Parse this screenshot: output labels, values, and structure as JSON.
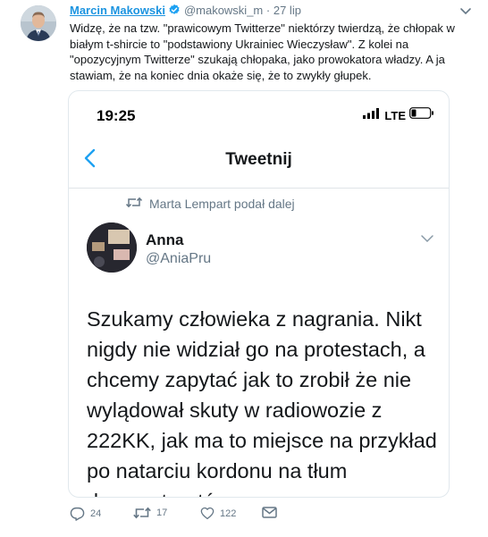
{
  "tweet": {
    "author_name": "Marcin Makowski",
    "author_handle": "@makowski_m",
    "separator": "·",
    "time": "27 lip",
    "text": "Widzę, że na tzw. \"prawicowym Twitterze\" niektórzy twierdzą, że chłopak w białym t-shircie to \"podstawiony Ukrainiec Wieczysław\". Z kolei na \"opozycyjnym Twitterze\" szukają chłopaka, jako prowokatora władzy. A ja stawiam, że na koniec dnia okaże się, że to zwykły głupek.",
    "icons": {
      "verified": "verified-badge-icon",
      "menu": "chevron-down-icon"
    }
  },
  "embedded": {
    "status_time": "19:25",
    "network": "LTE",
    "nav_title": "Tweetnij",
    "retweeted_by": "Marta Lempart podał dalej",
    "inner_name": "Anna",
    "inner_handle": "@AniaPru",
    "inner_text": "Szukamy człowieka z nagrania. Nikt nigdy nie widział go na protestach, a chcemy zapytać jak to zrobił że nie wylądował skuty w radiowozie z 222KK, jak ma to miejsce na przykład po natarciu kordonu na tłum demonstrantów."
  },
  "actions": {
    "replies": "24",
    "retweets": "17",
    "likes": "122"
  },
  "colors": {
    "link": "#1c94e0",
    "muted": "#657786",
    "text": "#14171a",
    "verified": "#1da1f2"
  }
}
